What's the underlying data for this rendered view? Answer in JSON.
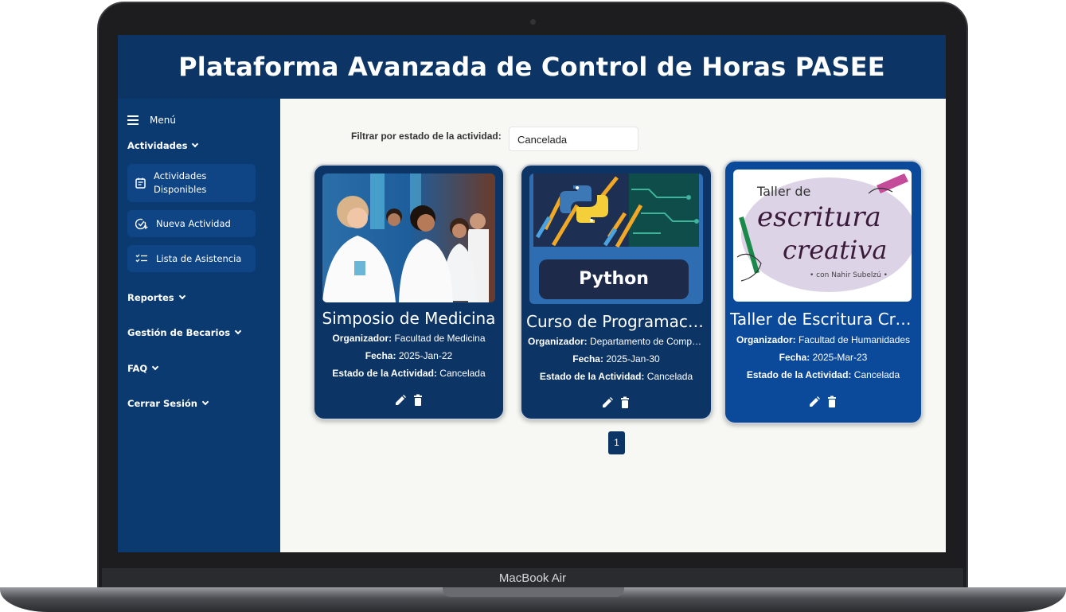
{
  "device": {
    "label": "MacBook Air"
  },
  "header": {
    "title": "Plataforma Avanzada de Control de Horas PASEE"
  },
  "sidebar": {
    "menu_label": "Menú",
    "sections": [
      {
        "label": "Actividades"
      },
      {
        "label": "Reportes"
      },
      {
        "label": "Gestión de Becarios"
      },
      {
        "label": "FAQ"
      },
      {
        "label": "Cerrar Sesión"
      }
    ],
    "items": [
      {
        "label": "Actividades Disponibles",
        "icon": "calendar-icon"
      },
      {
        "label": "Nueva Actividad",
        "icon": "check-add-icon"
      },
      {
        "label": "Lista de Asistencia",
        "icon": "checklist-icon"
      }
    ]
  },
  "filter": {
    "label": "Filtrar por estado de la actividad:",
    "value": "Cancelada"
  },
  "labels": {
    "organizer": "Organizador:",
    "date": "Fecha:",
    "status": "Estado de la Actividad:"
  },
  "cards": [
    {
      "title": "Simposio de Medicina",
      "organizer": "Facultad de Medicina",
      "date": "2025-Jan-22",
      "status": "Cancelada",
      "image": "medical-conference-photo"
    },
    {
      "title": "Curso de Programación",
      "organizer": "Departamento de Computación",
      "date": "2025-Jan-30",
      "status": "Cancelada",
      "image": "python-banner",
      "image_text": "Python"
    },
    {
      "title": "Taller de Escritura Creativa",
      "organizer": "Facultad de Humanidades",
      "date": "2025-Mar-23",
      "status": "Cancelada",
      "image": "writing-workshop-poster",
      "image_text": {
        "line1": "Taller de",
        "line2": "escritura",
        "line3": "creativa",
        "line4": "• con Nahir Subelzú •"
      }
    }
  ],
  "pagination": {
    "current_page": "1"
  },
  "colors": {
    "primary": "#0c3566",
    "sidebar": "#0b3a70",
    "card_active": "#0b4a9a",
    "background": "#f7f7f3"
  }
}
